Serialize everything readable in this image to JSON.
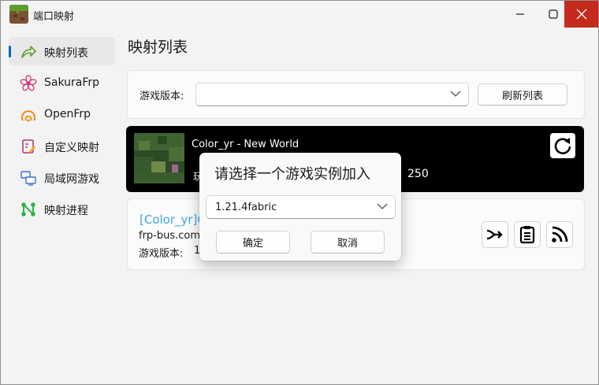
{
  "window": {
    "title": "端口映射"
  },
  "sidebar": {
    "items": [
      {
        "label": "映射列表",
        "active": true,
        "icon": "share-arrow-icon"
      },
      {
        "label": "SakuraFrp",
        "active": false,
        "icon": "sakura-flower-icon"
      },
      {
        "label": "OpenFrp",
        "active": false,
        "icon": "openfrp-logo-icon"
      },
      {
        "label": "自定义映射",
        "active": false,
        "icon": "custom-edit-icon"
      },
      {
        "label": "局域网游戏",
        "active": false,
        "icon": "lan-computers-icon"
      },
      {
        "label": "映射进程",
        "active": false,
        "icon": "process-graph-icon"
      }
    ]
  },
  "main": {
    "title": "映射列表",
    "version_selector": {
      "label": "游戏版本:",
      "value": ""
    },
    "refresh_label": "刷新列表",
    "world": {
      "name": "Color_yr - New World",
      "sub_prefix": "玩",
      "count": "250"
    },
    "tunnel": {
      "name": "[Color_yr]C",
      "address": "frp-bus.com",
      "version_label": "游戏版本:",
      "version_value": "1"
    }
  },
  "dialog": {
    "title": "请选择一个游戏实例加入",
    "selected": "1.21.4fabric",
    "ok_label": "确定",
    "cancel_label": "取消"
  },
  "colors": {
    "accent": "#0067c0",
    "close": "#c42b1c",
    "link": "#3ea6e0"
  }
}
